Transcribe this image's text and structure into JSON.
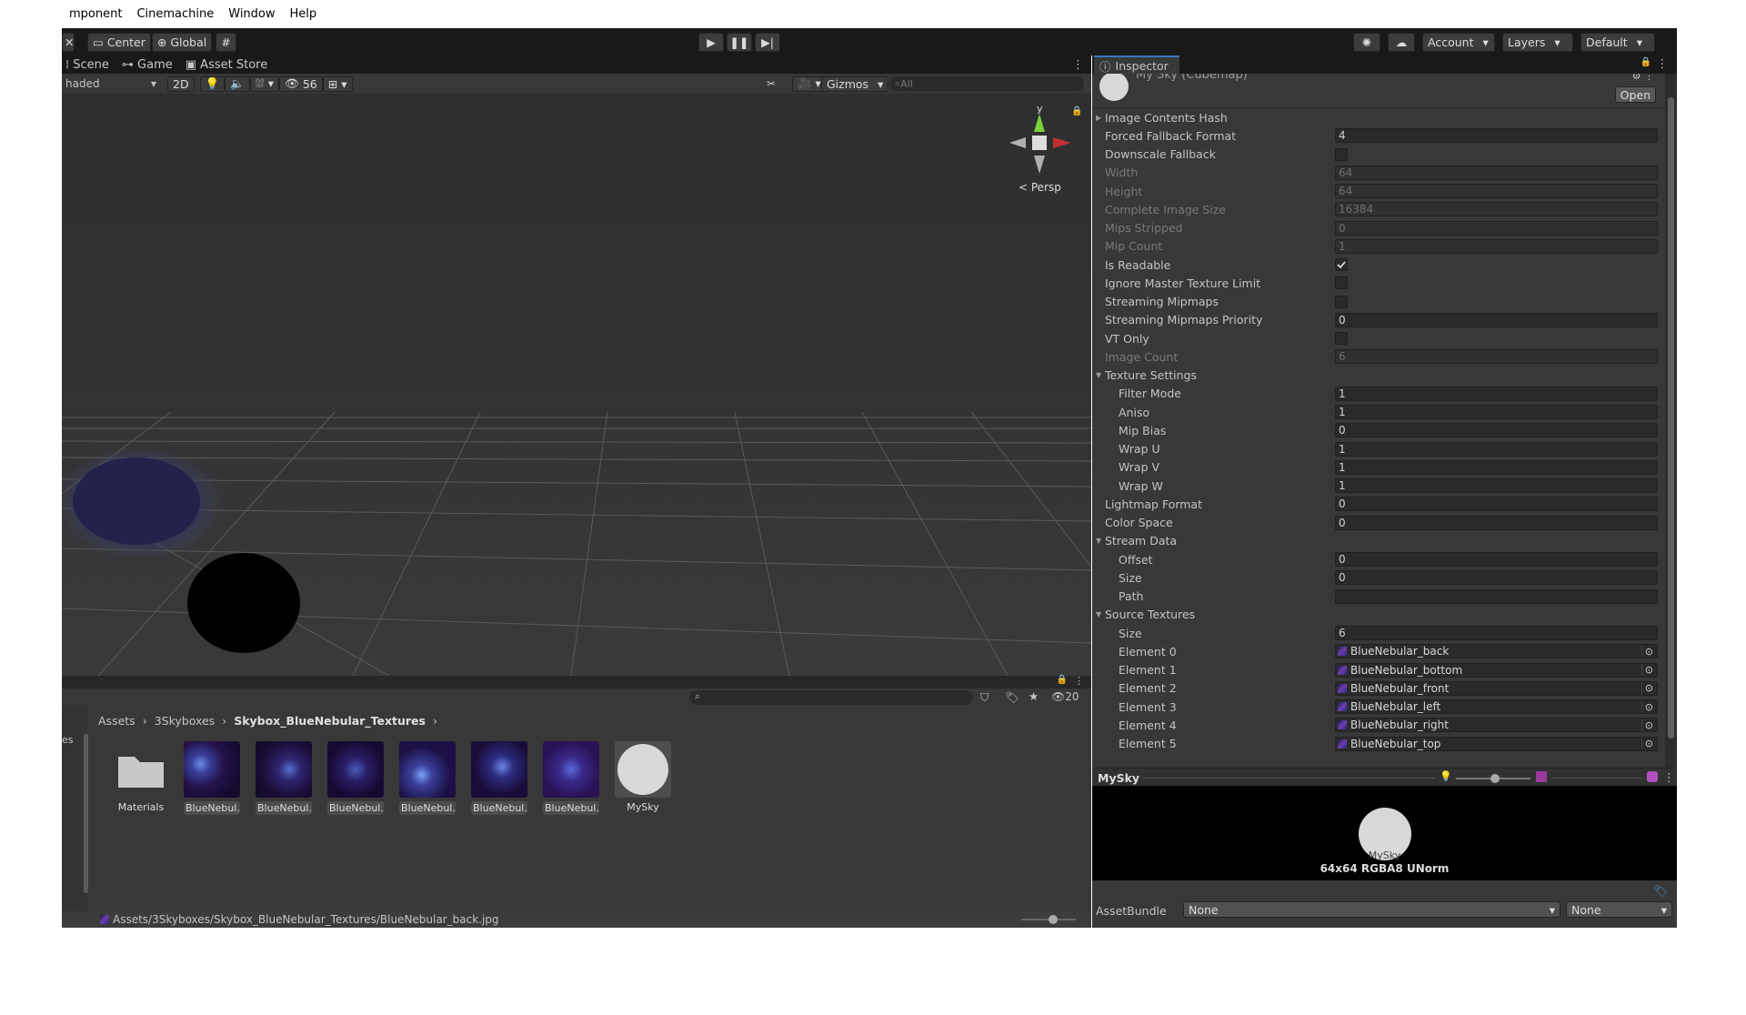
{
  "menubar": [
    "mponent",
    "Cinemachine",
    "Window",
    "Help"
  ],
  "toolbar": {
    "pivot": "Center",
    "space": "Global",
    "account": "Account",
    "layers": "Layers",
    "layout": "Default"
  },
  "scene_tabs": [
    "Scene",
    "Game",
    "Asset Store"
  ],
  "scene_tools": {
    "shading": "haded",
    "mode2d": "2D",
    "hidden_count": "56",
    "gizmos": "Gizmos",
    "search_placeholder": "All",
    "persp": "Persp",
    "axis_y": "y"
  },
  "project": {
    "breadcrumb": [
      "Assets",
      "3Skyboxes",
      "Skybox_BlueNebular_Textures"
    ],
    "side_label": "es",
    "count": "20",
    "assets": [
      {
        "name": "Materials",
        "kind": "folder"
      },
      {
        "name": "BlueNebul...",
        "kind": "texture"
      },
      {
        "name": "BlueNebul...",
        "kind": "texture"
      },
      {
        "name": "BlueNebul...",
        "kind": "texture"
      },
      {
        "name": "BlueNebul...",
        "kind": "texture"
      },
      {
        "name": "BlueNebul...",
        "kind": "texture"
      },
      {
        "name": "BlueNebul...",
        "kind": "texture"
      },
      {
        "name": "MySky",
        "kind": "cubemap"
      }
    ],
    "status_path": "Assets/3Skyboxes/Skybox_BlueNebular_Textures/BlueNebular_back.jpg"
  },
  "inspector": {
    "tab": "Inspector",
    "header_title": "My Sky (Cubemap)",
    "open_label": "Open",
    "rows": [
      {
        "label": "Image Contents Hash",
        "kind": "foldout-closed"
      },
      {
        "label": "Forced Fallback Format",
        "kind": "field",
        "value": "4"
      },
      {
        "label": "Downscale Fallback",
        "kind": "check",
        "checked": false
      },
      {
        "label": "Width",
        "kind": "field",
        "value": "64",
        "disabled": true
      },
      {
        "label": "Height",
        "kind": "field",
        "value": "64",
        "disabled": true
      },
      {
        "label": "Complete Image Size",
        "kind": "field",
        "value": "16384",
        "disabled": true
      },
      {
        "label": "Mips Stripped",
        "kind": "field",
        "value": "0",
        "disabled": true
      },
      {
        "label": "Mip Count",
        "kind": "field",
        "value": "1",
        "disabled": true
      },
      {
        "label": "Is Readable",
        "kind": "check",
        "checked": true
      },
      {
        "label": "Ignore Master Texture Limit",
        "kind": "check",
        "checked": false
      },
      {
        "label": "Streaming Mipmaps",
        "kind": "check",
        "checked": false
      },
      {
        "label": "Streaming Mipmaps Priority",
        "kind": "field",
        "value": "0"
      },
      {
        "label": "VT Only",
        "kind": "check",
        "checked": false
      },
      {
        "label": "Image Count",
        "kind": "field",
        "value": "6",
        "disabled": true
      },
      {
        "label": "Texture Settings",
        "kind": "foldout-open"
      },
      {
        "label": "Filter Mode",
        "kind": "field",
        "value": "1",
        "indent": true
      },
      {
        "label": "Aniso",
        "kind": "field",
        "value": "1",
        "indent": true
      },
      {
        "label": "Mip Bias",
        "kind": "field",
        "value": "0",
        "indent": true
      },
      {
        "label": "Wrap U",
        "kind": "field",
        "value": "1",
        "indent": true
      },
      {
        "label": "Wrap V",
        "kind": "field",
        "value": "1",
        "indent": true
      },
      {
        "label": "Wrap W",
        "kind": "field",
        "value": "1",
        "indent": true
      },
      {
        "label": "Lightmap Format",
        "kind": "field",
        "value": "0"
      },
      {
        "label": "Color Space",
        "kind": "field",
        "value": "0"
      },
      {
        "label": "Stream Data",
        "kind": "foldout-open"
      },
      {
        "label": "Offset",
        "kind": "field",
        "value": "0",
        "indent": true
      },
      {
        "label": "Size",
        "kind": "field",
        "value": "0",
        "indent": true
      },
      {
        "label": "Path",
        "kind": "field",
        "value": "",
        "indent": true
      },
      {
        "label": "Source Textures",
        "kind": "foldout-open"
      },
      {
        "label": "Size",
        "kind": "field",
        "value": "6",
        "indent": true
      },
      {
        "label": "Element 0",
        "kind": "object",
        "value": "BlueNebular_back",
        "indent": true
      },
      {
        "label": "Element 1",
        "kind": "object",
        "value": "BlueNebular_bottom",
        "indent": true
      },
      {
        "label": "Element 2",
        "kind": "object",
        "value": "BlueNebular_front",
        "indent": true
      },
      {
        "label": "Element 3",
        "kind": "object",
        "value": "BlueNebular_left",
        "indent": true
      },
      {
        "label": "Element 4",
        "kind": "object",
        "value": "BlueNebular_right",
        "indent": true
      },
      {
        "label": "Element 5",
        "kind": "object",
        "value": "BlueNebular_top",
        "indent": true
      }
    ],
    "preview_title": "MySky",
    "preview_name": "MySky",
    "preview_info": "64x64 RGBA8 UNorm",
    "assetbundle_label": "AssetBundle",
    "assetbundle_value": "None",
    "assetbundle_variant": "None"
  }
}
